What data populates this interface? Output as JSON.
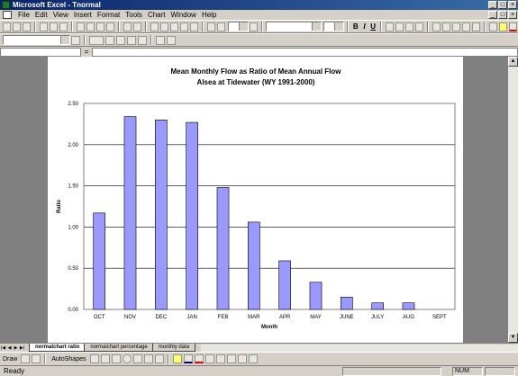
{
  "window": {
    "title": "Microsoft Excel - Tnormal"
  },
  "menu": [
    "File",
    "Edit",
    "View",
    "Insert",
    "Format",
    "Tools",
    "Chart",
    "Window",
    "Help"
  ],
  "formula_bar": {
    "equals": "="
  },
  "sheet_tabs": [
    "normalchart ratio",
    "normalchart percentage",
    "monthly data"
  ],
  "active_tab": 0,
  "draw_toolbar": {
    "draw_label": "Draw",
    "autoshapes_label": "AutoShapes"
  },
  "status": {
    "text": "Ready",
    "num": "NUM"
  },
  "colors": {
    "bar_fill": "#9999ff",
    "bar_stroke": "#000000",
    "titlebar": "#0a246a"
  },
  "chart_data": {
    "type": "bar",
    "title_lines": [
      "Mean Monthly Flow as Ratio of Mean Annual Flow",
      "Alsea at Tidewater (WY 1991-2000)"
    ],
    "xlabel": "Month",
    "ylabel": "Ratio",
    "categories": [
      "OCT",
      "NOV",
      "DEC",
      "JAN",
      "FEB",
      "MAR",
      "APR",
      "MAY",
      "JUNE",
      "JULY",
      "AUG",
      "SEPT"
    ],
    "values": [
      1.17,
      2.34,
      2.3,
      2.27,
      1.48,
      1.06,
      0.59,
      0.33,
      0.15,
      0.08,
      0.08,
      0.0
    ],
    "ylim": [
      0,
      2.5
    ],
    "yticks": [
      "0.00",
      "0.50",
      "1.00",
      "1.50",
      "2.00",
      "2.50"
    ],
    "grid": true,
    "legend": "none"
  }
}
